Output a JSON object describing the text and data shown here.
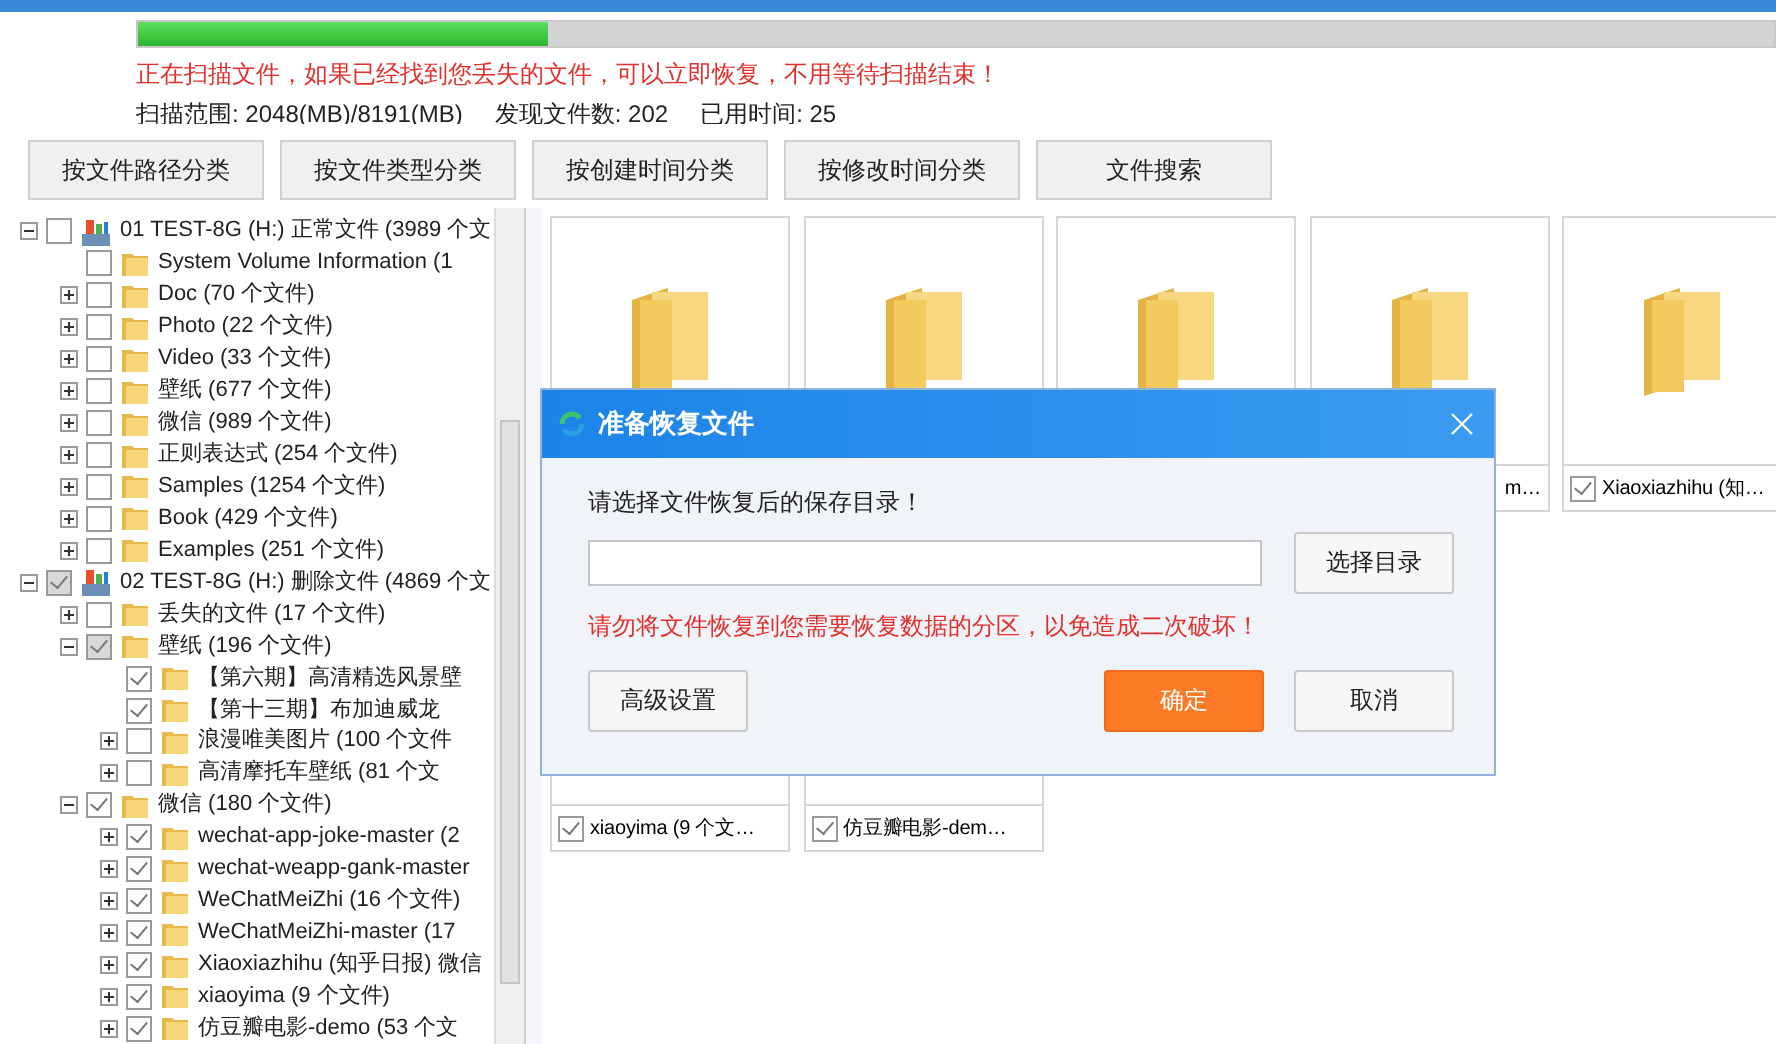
{
  "scan": {
    "level": 0.25,
    "message": "正在扫描文件，如果已经找到您丢失的文件，可以立即恢复，不用等待扫描结束！",
    "range": "扫描范围: 2048(MB)/8191(MB)",
    "found": "发现文件数: 202",
    "elapsed": "已用时间: 25"
  },
  "tabs": [
    {
      "label": "按文件路径分类",
      "selected": false
    },
    {
      "label": "按文件类型分类",
      "selected": false
    },
    {
      "label": "按创建时间分类",
      "selected": false
    },
    {
      "label": "按修改时间分类",
      "selected": false
    },
    {
      "label": "文件搜索",
      "selected": false
    }
  ],
  "tree": [
    {
      "label": "01 TEST-8G (H:) 正常文件 (3989 个文",
      "kind": "drive",
      "checked": false,
      "partial": false,
      "expanded": true,
      "children": [
        {
          "label": "System Volume Information    (1",
          "kind": "folder",
          "checked": false,
          "partial": false
        },
        {
          "label": "Doc    (70 个文件)",
          "kind": "folder",
          "checked": false,
          "partial": false,
          "expanded": false
        },
        {
          "label": "Photo    (22 个文件)",
          "kind": "folder",
          "checked": false,
          "partial": false,
          "expanded": false
        },
        {
          "label": "Video    (33 个文件)",
          "kind": "folder",
          "checked": false,
          "partial": false,
          "expanded": false
        },
        {
          "label": "壁纸    (677 个文件)",
          "kind": "folder",
          "checked": false,
          "partial": false,
          "expanded": false
        },
        {
          "label": "微信    (989 个文件)",
          "kind": "folder",
          "checked": false,
          "partial": false,
          "expanded": false
        },
        {
          "label": "正则表达式    (254 个文件)",
          "kind": "folder",
          "checked": false,
          "partial": false,
          "expanded": false
        },
        {
          "label": "Samples    (1254 个文件)",
          "kind": "folder",
          "checked": false,
          "partial": false,
          "expanded": false
        },
        {
          "label": "Book    (429 个文件)",
          "kind": "folder",
          "checked": false,
          "partial": false,
          "expanded": false
        },
        {
          "label": "Examples    (251 个文件)",
          "kind": "folder",
          "checked": false,
          "partial": false,
          "expanded": false
        }
      ]
    },
    {
      "label": "02 TEST-8G (H:) 删除文件 (4869 个文",
      "kind": "drive",
      "checked": true,
      "partial": true,
      "expanded": true,
      "children": [
        {
          "label": "丢失的文件    (17 个文件)",
          "kind": "folder",
          "checked": false,
          "partial": false,
          "expanded": false
        },
        {
          "label": "壁纸    (196 个文件)",
          "kind": "folder",
          "checked": true,
          "partial": true,
          "expanded": true,
          "children": [
            {
              "label": "【第六期】高清精选风景壁",
              "kind": "folder",
              "checked": true,
              "partial": false
            },
            {
              "label": "【第十三期】布加迪威龙",
              "kind": "folder",
              "checked": true,
              "partial": false
            },
            {
              "label": "浪漫唯美图片    (100 个文件",
              "kind": "folder",
              "checked": false,
              "partial": false,
              "expanded": false
            },
            {
              "label": "高清摩托车壁纸    (81 个文",
              "kind": "folder",
              "checked": false,
              "partial": false,
              "expanded": false
            }
          ]
        },
        {
          "label": "微信    (180 个文件)",
          "kind": "folder",
          "checked": true,
          "partial": false,
          "expanded": true,
          "children": [
            {
              "label": "wechat-app-joke-master    (2",
              "kind": "folder",
              "checked": true,
              "partial": false,
              "expanded": false
            },
            {
              "label": "wechat-weapp-gank-master",
              "kind": "folder",
              "checked": true,
              "partial": false,
              "expanded": false
            },
            {
              "label": "WeChatMeiZhi    (16 个文件)",
              "kind": "folder",
              "checked": true,
              "partial": false,
              "expanded": false
            },
            {
              "label": "WeChatMeiZhi-master    (17",
              "kind": "folder",
              "checked": true,
              "partial": false,
              "expanded": false
            },
            {
              "label": "Xiaoxiazhihu (知乎日报) 微信",
              "kind": "folder",
              "checked": true,
              "partial": false,
              "expanded": false
            },
            {
              "label": "xiaoyima    (9 个文件)",
              "kind": "folder",
              "checked": true,
              "partial": false,
              "expanded": false
            },
            {
              "label": "仿豆瓣电影-demo    (53 个文",
              "kind": "folder",
              "checked": true,
              "partial": false,
              "expanded": false
            }
          ]
        }
      ]
    }
  ],
  "tiles": [
    {
      "folder": true
    },
    {
      "folder": true
    },
    {
      "folder": true
    },
    {
      "folder": true,
      "label": "m…"
    },
    {
      "folder": true,
      "label": "Xiaoxiazhihu (知…",
      "checked": true
    },
    {
      "label": "xiaoyima  (9 个文…",
      "checked": true
    },
    {
      "label": "仿豆瓣电影-dem…",
      "checked": true
    }
  ],
  "dialog": {
    "title": "准备恢复文件",
    "prompt": "请选择文件恢复后的保存目录！",
    "browse": "选择目录",
    "warning": "请勿将文件恢复到您需要恢复数据的分区，以免造成二次破坏！",
    "advanced": "高级设置",
    "ok": "确定",
    "cancel": "取消"
  }
}
